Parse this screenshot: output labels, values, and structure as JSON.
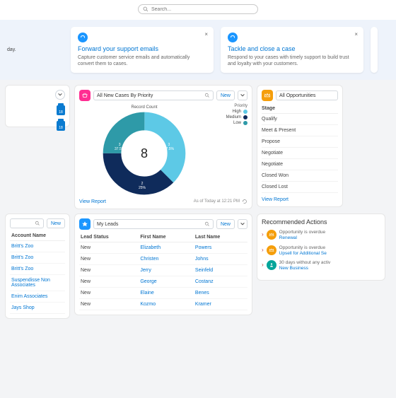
{
  "search": {
    "placeholder": "Search..."
  },
  "day_text": "day.",
  "tips": [
    {
      "title": "Forward your support emails",
      "desc": "Capture customer service emails and automatically convert them to cases."
    },
    {
      "title": "Tackle and close a case",
      "desc": "Respond to your cases with timely support to build trust and loyalty with your customers."
    }
  ],
  "clip_badge": "18",
  "cases_panel": {
    "select": "All New Cases By Priority",
    "new_btn": "New",
    "chart_title": "Record Count",
    "legend_title": "Priority",
    "view_report": "View Report",
    "as_of": "As of Today at 12:21 PM"
  },
  "chart_data": {
    "type": "pie",
    "title": "Record Count",
    "center_total": 8,
    "series": [
      {
        "name": "High",
        "value": 3,
        "pct": "37.5%",
        "color": "#5dc9e6"
      },
      {
        "name": "Medium",
        "value": 3,
        "pct": "37.5%",
        "color": "#0f2b5b"
      },
      {
        "name": "Low",
        "value": 2,
        "pct": "25%",
        "color": "#2e9aa8"
      }
    ]
  },
  "opps_panel": {
    "select": "All Opportunities",
    "col": "Stage",
    "rows": [
      "Qualify",
      "Meet & Present",
      "Propose",
      "Negotiate",
      "Negotiate",
      "Closed Won",
      "Closed Lost"
    ],
    "view_report": "View Report"
  },
  "accounts_panel": {
    "new_btn": "New",
    "col": "Account Name",
    "rows": [
      "Britt's Zoo",
      "Britt's Zoo",
      "Britt's Zoo",
      "Suspendisse Non Associates",
      "Enim Associates",
      "Jays Shop"
    ]
  },
  "leads_panel": {
    "select": "My Leads",
    "new_btn": "New",
    "cols": [
      "Lead Status",
      "First Name",
      "Last Name"
    ],
    "rows": [
      {
        "status": "New",
        "first": "Elizabeth",
        "last": "Powers"
      },
      {
        "status": "New",
        "first": "Christen",
        "last": "Johns"
      },
      {
        "status": "New",
        "first": "Jerry",
        "last": "Seinfeld"
      },
      {
        "status": "New",
        "first": "George",
        "last": "Costanz"
      },
      {
        "status": "New",
        "first": "Elaine",
        "last": "Benes"
      },
      {
        "status": "New",
        "first": "Kozmo",
        "last": "Kramer"
      }
    ]
  },
  "recs": {
    "title": "Recommended Actions",
    "items": [
      {
        "badge": "orange",
        "text": "Opportunity is overdue",
        "link": "Renewal"
      },
      {
        "badge": "orange",
        "text": "Opportunity is overdue",
        "link": "Upsell for Additional Se"
      },
      {
        "badge": "teal",
        "text": "30 days without any activ",
        "link": "New Business"
      }
    ]
  }
}
